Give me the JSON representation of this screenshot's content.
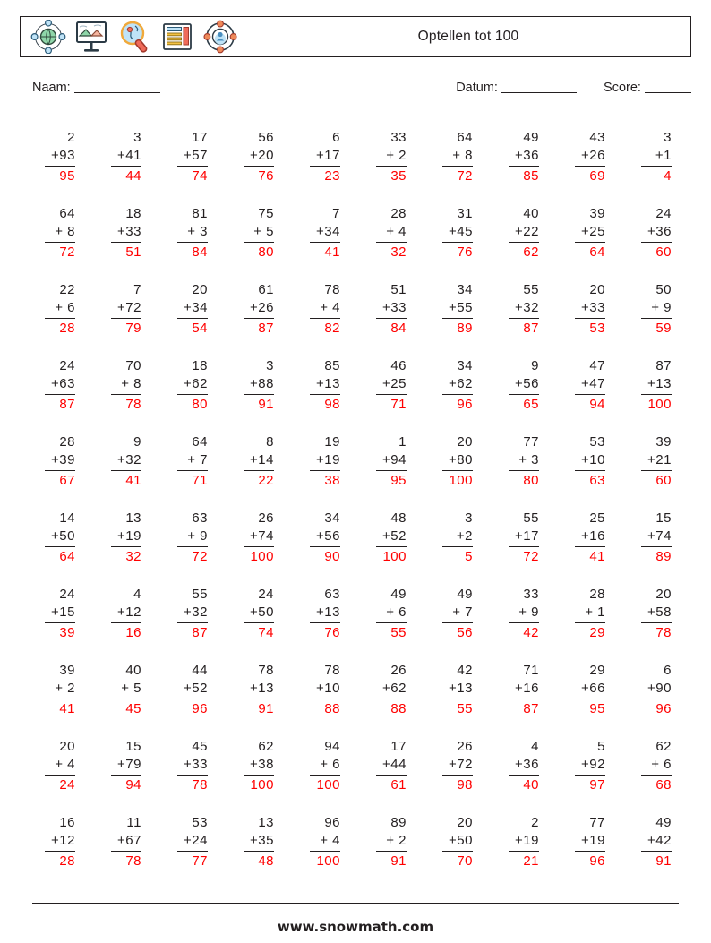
{
  "header": {
    "title": "Optellen tot 100",
    "icons": [
      "network-globe-icon",
      "presentation-board-icon",
      "magnifier-globe-icon",
      "document-list-icon",
      "lifebuoy-user-icon"
    ]
  },
  "meta": {
    "name_label": "Naam:",
    "date_label": "Datum:",
    "score_label": "Score:"
  },
  "footer": {
    "website": "www.snowmath.com"
  },
  "colors": {
    "ink": "#231f20",
    "answer": "#ff0000"
  },
  "problems": [
    {
      "top": "2",
      "bottom": "+93",
      "sum": "95"
    },
    {
      "top": "3",
      "bottom": "+41",
      "sum": "44"
    },
    {
      "top": "17",
      "bottom": "+57",
      "sum": "74"
    },
    {
      "top": "56",
      "bottom": "+20",
      "sum": "76"
    },
    {
      "top": "6",
      "bottom": "+17",
      "sum": "23"
    },
    {
      "top": "33",
      "bottom": "+ 2",
      "sum": "35"
    },
    {
      "top": "64",
      "bottom": "+ 8",
      "sum": "72"
    },
    {
      "top": "49",
      "bottom": "+36",
      "sum": "85"
    },
    {
      "top": "43",
      "bottom": "+26",
      "sum": "69"
    },
    {
      "top": "3",
      "bottom": "+1",
      "sum": "4"
    },
    {
      "top": "64",
      "bottom": "+ 8",
      "sum": "72"
    },
    {
      "top": "18",
      "bottom": "+33",
      "sum": "51"
    },
    {
      "top": "81",
      "bottom": "+ 3",
      "sum": "84"
    },
    {
      "top": "75",
      "bottom": "+ 5",
      "sum": "80"
    },
    {
      "top": "7",
      "bottom": "+34",
      "sum": "41"
    },
    {
      "top": "28",
      "bottom": "+ 4",
      "sum": "32"
    },
    {
      "top": "31",
      "bottom": "+45",
      "sum": "76"
    },
    {
      "top": "40",
      "bottom": "+22",
      "sum": "62"
    },
    {
      "top": "39",
      "bottom": "+25",
      "sum": "64"
    },
    {
      "top": "24",
      "bottom": "+36",
      "sum": "60"
    },
    {
      "top": "22",
      "bottom": "+ 6",
      "sum": "28"
    },
    {
      "top": "7",
      "bottom": "+72",
      "sum": "79"
    },
    {
      "top": "20",
      "bottom": "+34",
      "sum": "54"
    },
    {
      "top": "61",
      "bottom": "+26",
      "sum": "87"
    },
    {
      "top": "78",
      "bottom": "+ 4",
      "sum": "82"
    },
    {
      "top": "51",
      "bottom": "+33",
      "sum": "84"
    },
    {
      "top": "34",
      "bottom": "+55",
      "sum": "89"
    },
    {
      "top": "55",
      "bottom": "+32",
      "sum": "87"
    },
    {
      "top": "20",
      "bottom": "+33",
      "sum": "53"
    },
    {
      "top": "50",
      "bottom": "+ 9",
      "sum": "59"
    },
    {
      "top": "24",
      "bottom": "+63",
      "sum": "87"
    },
    {
      "top": "70",
      "bottom": "+ 8",
      "sum": "78"
    },
    {
      "top": "18",
      "bottom": "+62",
      "sum": "80"
    },
    {
      "top": "3",
      "bottom": "+88",
      "sum": "91"
    },
    {
      "top": "85",
      "bottom": "+13",
      "sum": "98"
    },
    {
      "top": "46",
      "bottom": "+25",
      "sum": "71"
    },
    {
      "top": "34",
      "bottom": "+62",
      "sum": "96"
    },
    {
      "top": "9",
      "bottom": "+56",
      "sum": "65"
    },
    {
      "top": "47",
      "bottom": "+47",
      "sum": "94"
    },
    {
      "top": "87",
      "bottom": "+13",
      "sum": "100"
    },
    {
      "top": "28",
      "bottom": "+39",
      "sum": "67"
    },
    {
      "top": "9",
      "bottom": "+32",
      "sum": "41"
    },
    {
      "top": "64",
      "bottom": "+ 7",
      "sum": "71"
    },
    {
      "top": "8",
      "bottom": "+14",
      "sum": "22"
    },
    {
      "top": "19",
      "bottom": "+19",
      "sum": "38"
    },
    {
      "top": "1",
      "bottom": "+94",
      "sum": "95"
    },
    {
      "top": "20",
      "bottom": "+80",
      "sum": "100"
    },
    {
      "top": "77",
      "bottom": "+ 3",
      "sum": "80"
    },
    {
      "top": "53",
      "bottom": "+10",
      "sum": "63"
    },
    {
      "top": "39",
      "bottom": "+21",
      "sum": "60"
    },
    {
      "top": "14",
      "bottom": "+50",
      "sum": "64"
    },
    {
      "top": "13",
      "bottom": "+19",
      "sum": "32"
    },
    {
      "top": "63",
      "bottom": "+ 9",
      "sum": "72"
    },
    {
      "top": "26",
      "bottom": "+74",
      "sum": "100"
    },
    {
      "top": "34",
      "bottom": "+56",
      "sum": "90"
    },
    {
      "top": "48",
      "bottom": "+52",
      "sum": "100"
    },
    {
      "top": "3",
      "bottom": "+2",
      "sum": "5"
    },
    {
      "top": "55",
      "bottom": "+17",
      "sum": "72"
    },
    {
      "top": "25",
      "bottom": "+16",
      "sum": "41"
    },
    {
      "top": "15",
      "bottom": "+74",
      "sum": "89"
    },
    {
      "top": "24",
      "bottom": "+15",
      "sum": "39"
    },
    {
      "top": "4",
      "bottom": "+12",
      "sum": "16"
    },
    {
      "top": "55",
      "bottom": "+32",
      "sum": "87"
    },
    {
      "top": "24",
      "bottom": "+50",
      "sum": "74"
    },
    {
      "top": "63",
      "bottom": "+13",
      "sum": "76"
    },
    {
      "top": "49",
      "bottom": "+ 6",
      "sum": "55"
    },
    {
      "top": "49",
      "bottom": "+ 7",
      "sum": "56"
    },
    {
      "top": "33",
      "bottom": "+ 9",
      "sum": "42"
    },
    {
      "top": "28",
      "bottom": "+ 1",
      "sum": "29"
    },
    {
      "top": "20",
      "bottom": "+58",
      "sum": "78"
    },
    {
      "top": "39",
      "bottom": "+ 2",
      "sum": "41"
    },
    {
      "top": "40",
      "bottom": "+ 5",
      "sum": "45"
    },
    {
      "top": "44",
      "bottom": "+52",
      "sum": "96"
    },
    {
      "top": "78",
      "bottom": "+13",
      "sum": "91"
    },
    {
      "top": "78",
      "bottom": "+10",
      "sum": "88"
    },
    {
      "top": "26",
      "bottom": "+62",
      "sum": "88"
    },
    {
      "top": "42",
      "bottom": "+13",
      "sum": "55"
    },
    {
      "top": "71",
      "bottom": "+16",
      "sum": "87"
    },
    {
      "top": "29",
      "bottom": "+66",
      "sum": "95"
    },
    {
      "top": "6",
      "bottom": "+90",
      "sum": "96"
    },
    {
      "top": "20",
      "bottom": "+ 4",
      "sum": "24"
    },
    {
      "top": "15",
      "bottom": "+79",
      "sum": "94"
    },
    {
      "top": "45",
      "bottom": "+33",
      "sum": "78"
    },
    {
      "top": "62",
      "bottom": "+38",
      "sum": "100"
    },
    {
      "top": "94",
      "bottom": "+ 6",
      "sum": "100"
    },
    {
      "top": "17",
      "bottom": "+44",
      "sum": "61"
    },
    {
      "top": "26",
      "bottom": "+72",
      "sum": "98"
    },
    {
      "top": "4",
      "bottom": "+36",
      "sum": "40"
    },
    {
      "top": "5",
      "bottom": "+92",
      "sum": "97"
    },
    {
      "top": "62",
      "bottom": "+ 6",
      "sum": "68"
    },
    {
      "top": "16",
      "bottom": "+12",
      "sum": "28"
    },
    {
      "top": "11",
      "bottom": "+67",
      "sum": "78"
    },
    {
      "top": "53",
      "bottom": "+24",
      "sum": "77"
    },
    {
      "top": "13",
      "bottom": "+35",
      "sum": "48"
    },
    {
      "top": "96",
      "bottom": "+ 4",
      "sum": "100"
    },
    {
      "top": "89",
      "bottom": "+ 2",
      "sum": "91"
    },
    {
      "top": "20",
      "bottom": "+50",
      "sum": "70"
    },
    {
      "top": "2",
      "bottom": "+19",
      "sum": "21"
    },
    {
      "top": "77",
      "bottom": "+19",
      "sum": "96"
    },
    {
      "top": "49",
      "bottom": "+42",
      "sum": "91"
    }
  ]
}
